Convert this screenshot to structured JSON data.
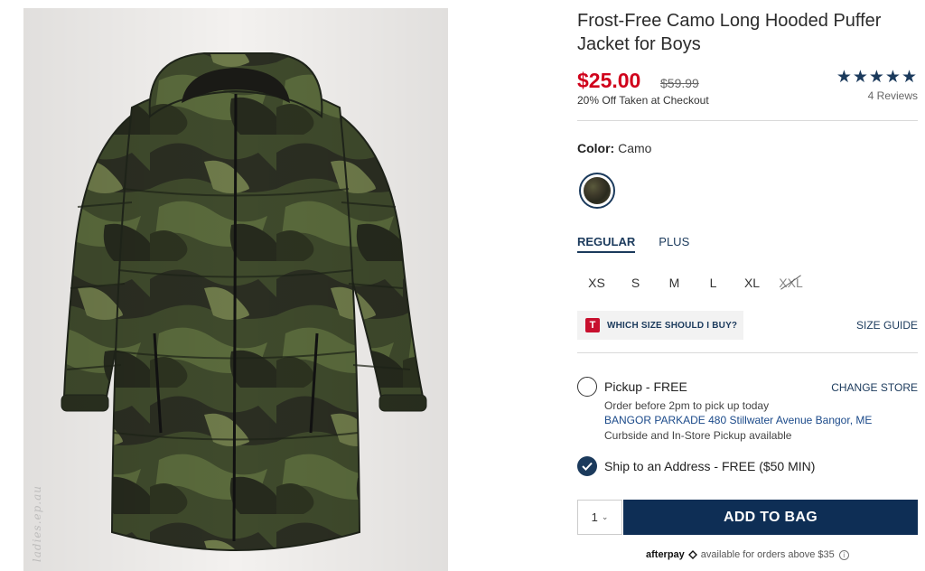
{
  "product": {
    "title": "Frost-Free Camo Long Hooded Puffer Jacket for Boys",
    "sale_price": "$25.00",
    "original_price": "$59.99",
    "discount_note": "20% Off Taken at Checkout",
    "rating_stars": "★★★★★",
    "reviews": "4 Reviews",
    "watermark": "ladies.ep.au"
  },
  "color": {
    "label": "Color:",
    "value": "Camo",
    "swatch_icon": "camo-swatch"
  },
  "fit_tabs": [
    {
      "label": "REGULAR",
      "active": true
    },
    {
      "label": "PLUS",
      "active": false
    }
  ],
  "sizes": [
    {
      "label": "XS",
      "available": true
    },
    {
      "label": "S",
      "available": true
    },
    {
      "label": "M",
      "available": true
    },
    {
      "label": "L",
      "available": true
    },
    {
      "label": "XL",
      "available": true
    },
    {
      "label": "XXL",
      "available": false
    }
  ],
  "size_help": {
    "badge": "T",
    "label": "WHICH SIZE SHOULD I BUY?",
    "guide_link": "SIZE GUIDE"
  },
  "pickup": {
    "title": "Pickup - FREE",
    "change_store": "CHANGE STORE",
    "note": "Order before 2pm to pick up today",
    "store": "BANGOR PARKADE 480 Stillwater Avenue  Bangor, ME",
    "curbside": "Curbside and In-Store Pickup available"
  },
  "shipping": {
    "label": "Ship to an Address - FREE ($50 MIN)",
    "selected": true
  },
  "cart": {
    "quantity": "1",
    "add_button": "ADD TO BAG"
  },
  "afterpay": {
    "logo": "afterpay",
    "text": "available for orders above $35",
    "info_icon": "ⓘ"
  },
  "colors": {
    "sale_red": "#d0021b",
    "navy": "#1b3a5c",
    "button_navy": "#0e2e55"
  }
}
